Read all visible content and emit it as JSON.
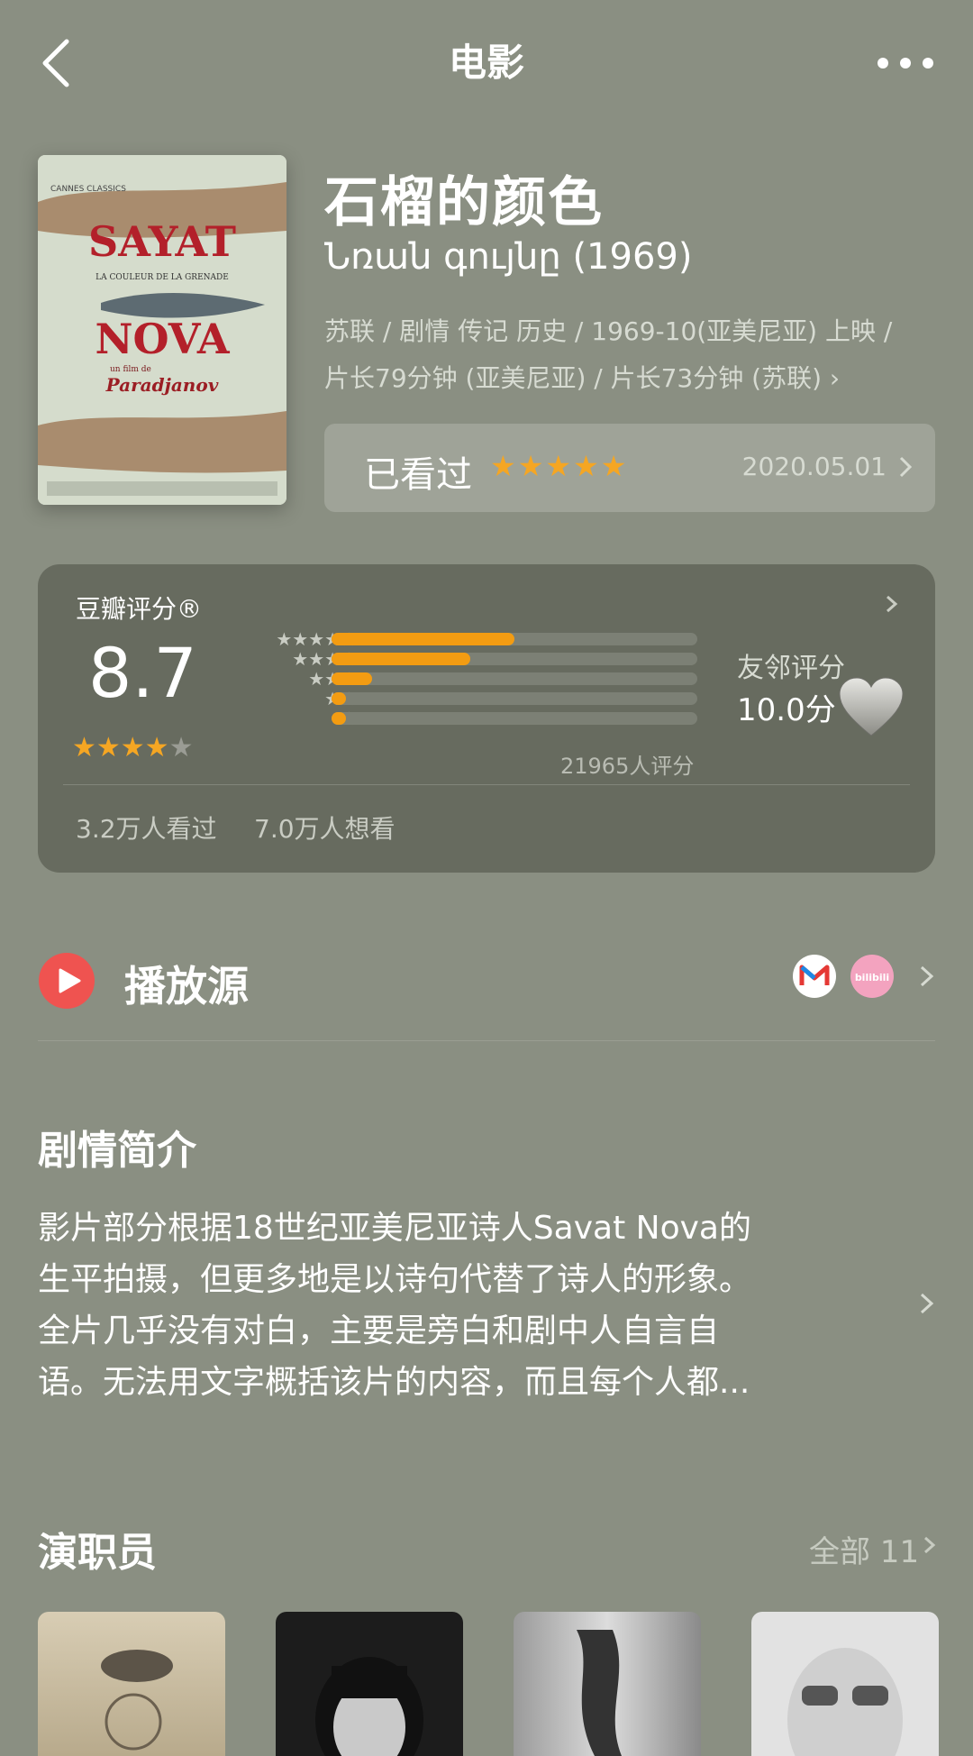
{
  "header": {
    "title": "电影",
    "back_icon": "back-icon",
    "more_icon": "more-icon"
  },
  "movie": {
    "title_cn": "石榴的颜色",
    "title_original": "Նռան գույնը (1969)",
    "meta_line1": "苏联 / 剧情 传记 历史 / 1969-10(亚美尼亚) 上映 /",
    "meta_line2": "片长79分钟 (亚美尼亚) / 片长73分钟 (苏联)",
    "poster": {
      "festival": "CANNES CLASSICS",
      "title_line1": "SAYAT",
      "title_line2": "NOVA",
      "subtitle": "LA COULEUR DE LA GRENADE",
      "by": "un film de",
      "director": "Paradjanov"
    }
  },
  "watched": {
    "label": "已看过",
    "stars": "★★★★★",
    "date": "2020.05.01"
  },
  "rating": {
    "source": "豆瓣评分®",
    "score": "8.7",
    "stars_full": "★★★★",
    "stars_half": "★",
    "distribution": [
      {
        "stars": "★★★★★",
        "fraction": 0.5
      },
      {
        "stars": "★★★★",
        "fraction": 0.38
      },
      {
        "stars": "★★★",
        "fraction": 0.11
      },
      {
        "stars": "★★",
        "fraction": 0.04
      },
      {
        "stars": "★",
        "fraction": 0.04
      }
    ],
    "count": "21965人评分",
    "friend_label": "友邻评分",
    "friend_score": "10.0分",
    "seen": "3.2万人看过",
    "want": "7.0万人想看"
  },
  "play": {
    "label": "播放源",
    "sources": [
      "mgtv-icon",
      "bilibili-icon"
    ],
    "bilibili_text": "bilibili"
  },
  "synopsis": {
    "heading": "剧情简介",
    "lines": [
      "影片部分根据18世纪亚美尼亚诗人Savat Nova的",
      "生平拍摄，但更多地是以诗句代替了诗人的形象。",
      "全片几乎没有对白，主要是旁白和剧中人自言自",
      "语。无法用文字概括该片的内容，而且每个人都..."
    ]
  },
  "cast": {
    "heading": "演职员",
    "all_label": "全部 11"
  },
  "colors": {
    "accent_star": "#f5a623",
    "bar": "#f39c12",
    "background": "#8a8f82",
    "card": "#676b5f"
  }
}
